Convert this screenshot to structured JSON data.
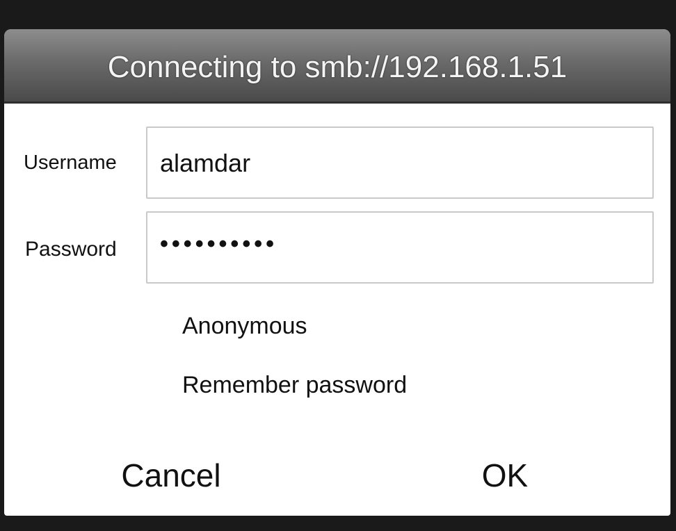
{
  "dialog": {
    "title": "Connecting to smb://192.168.1.51",
    "username": {
      "label": "Username",
      "value": "alamdar"
    },
    "password": {
      "label": "Password",
      "value": "••••••••••"
    },
    "options": {
      "anonymous": "Anonymous",
      "remember_password": "Remember password"
    },
    "buttons": {
      "cancel": "Cancel",
      "ok": "OK"
    }
  },
  "colors": {
    "title_bar": "#6a6a6a",
    "title_text": "#f4f4f4",
    "dialog_bg": "#ffffff",
    "input_border": "#c9c9c9",
    "text": "#111111"
  }
}
